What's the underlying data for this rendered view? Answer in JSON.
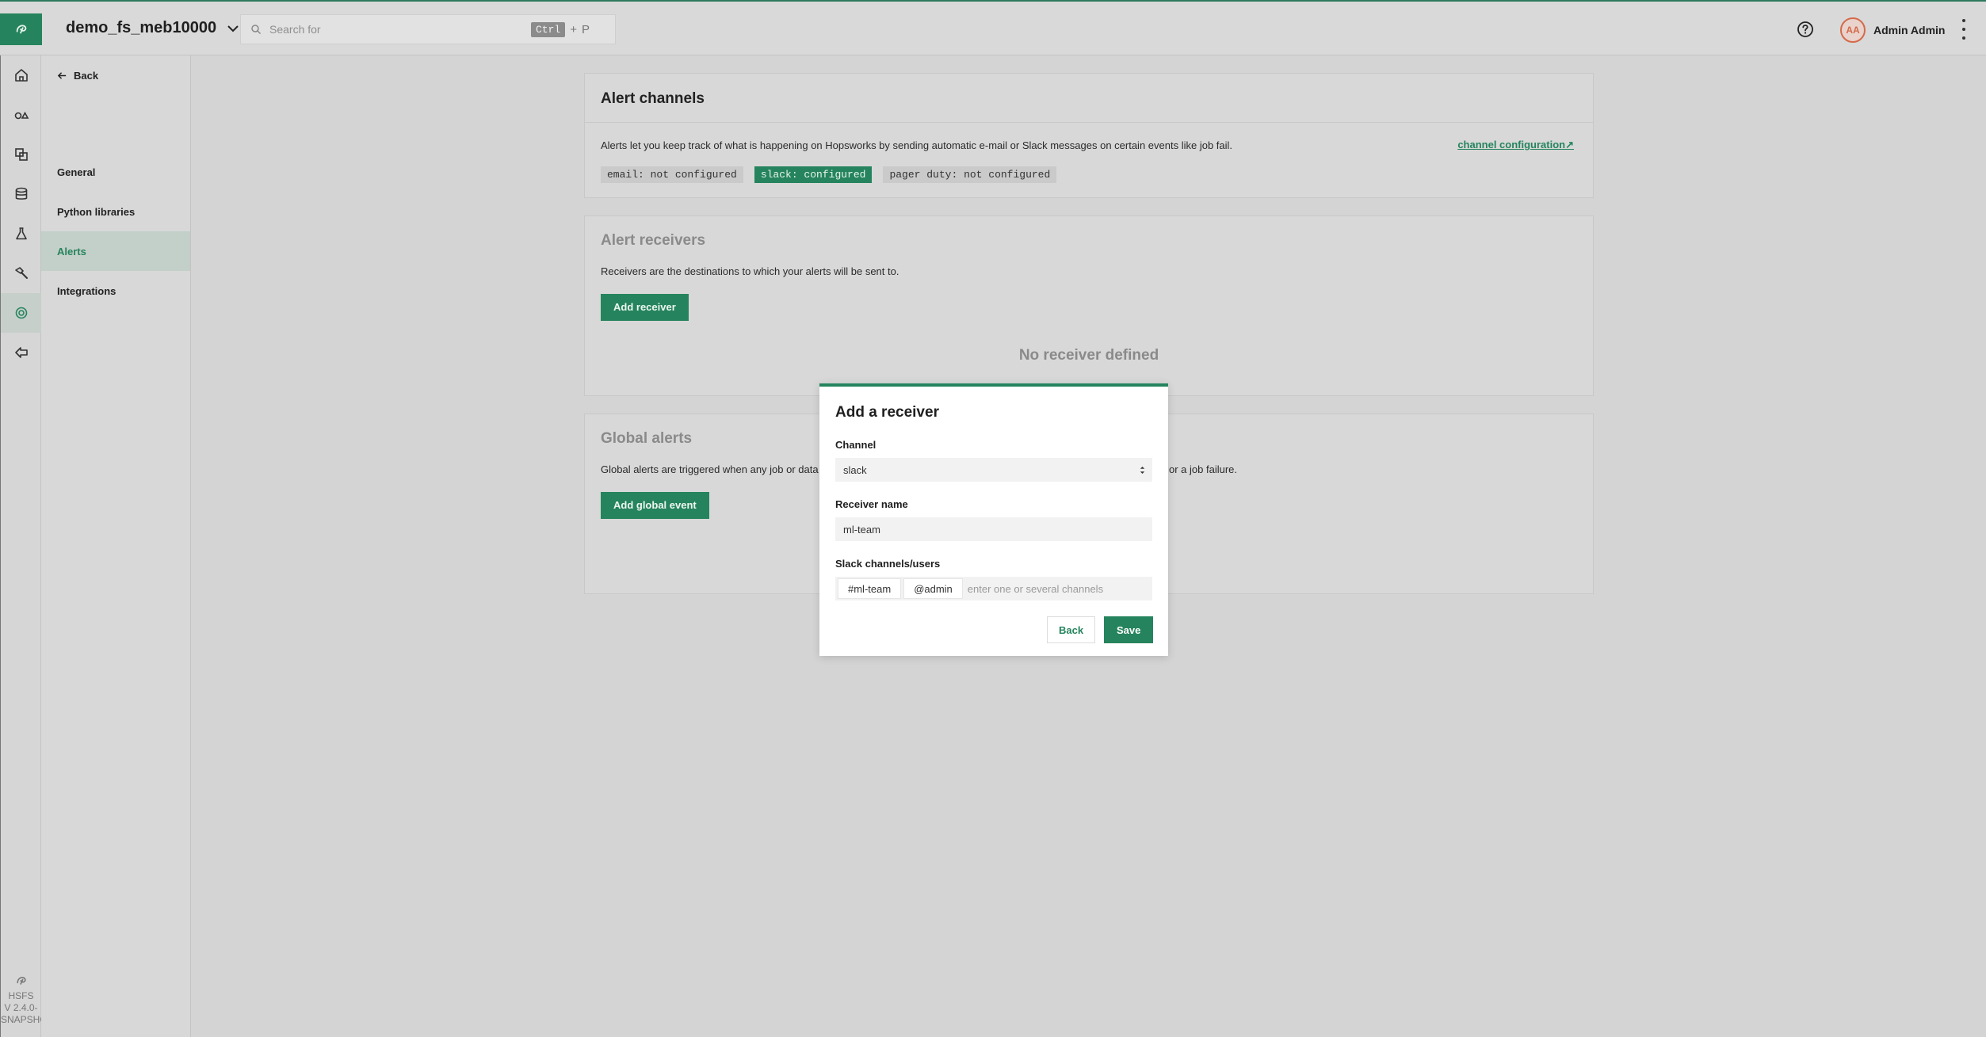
{
  "topbar": {
    "project_name": "demo_fs_meb10000",
    "search_placeholder": "Search for",
    "shortcut_modifier": "Ctrl",
    "shortcut_plus": "+",
    "shortcut_key": "P",
    "user_initials": "AA",
    "user_name": "Admin Admin"
  },
  "rail": {
    "items": [
      {
        "icon": "home-icon"
      },
      {
        "icon": "feature-groups-icon"
      },
      {
        "icon": "feature-views-icon"
      },
      {
        "icon": "database-icon"
      },
      {
        "icon": "flask-icon"
      },
      {
        "icon": "hammer-icon"
      },
      {
        "icon": "settings-icon",
        "active": true
      },
      {
        "icon": "exit-icon"
      }
    ],
    "footer_line1": "HSFS",
    "footer_line2": "V 2.4.0-",
    "footer_line3": "SNAPSHOT"
  },
  "sidebar": {
    "back_label": "Back",
    "items": [
      {
        "label": "General"
      },
      {
        "label": "Python libraries"
      },
      {
        "label": "Alerts",
        "active": true
      },
      {
        "label": "Integrations"
      }
    ]
  },
  "alert_channels": {
    "title": "Alert channels",
    "description": "Alerts let you keep track of what is happening on Hopsworks by sending automatic e-mail or Slack messages on certain events like job fail.",
    "config_link": "channel configuration↗",
    "tags": [
      {
        "label": "email: not configured",
        "configured": false
      },
      {
        "label": "slack: configured",
        "configured": true
      },
      {
        "label": "pager duty: not configured",
        "configured": false
      }
    ]
  },
  "alert_receivers": {
    "title": "Alert receivers",
    "description": "Receivers are the destinations to which your alerts will be sent to.",
    "add_button": "Add receiver",
    "empty_text": "No receiver defined"
  },
  "global_alerts": {
    "title": "Global alerts",
    "description_left": "Global alerts are triggered when any job or data",
    "description_right": "or a job failure.",
    "add_button": "Add global event"
  },
  "modal": {
    "title": "Add a receiver",
    "channel_label": "Channel",
    "channel_value": "slack",
    "receiver_name_label": "Receiver name",
    "receiver_name_value": "ml-team",
    "slack_label": "Slack channels/users",
    "chips": [
      "#ml-team",
      "@admin"
    ],
    "chips_placeholder": "enter one or several channels",
    "back_button": "Back",
    "save_button": "Save"
  },
  "colors": {
    "accent": "#25845d",
    "overlay_bg": "#d4d4d4"
  }
}
